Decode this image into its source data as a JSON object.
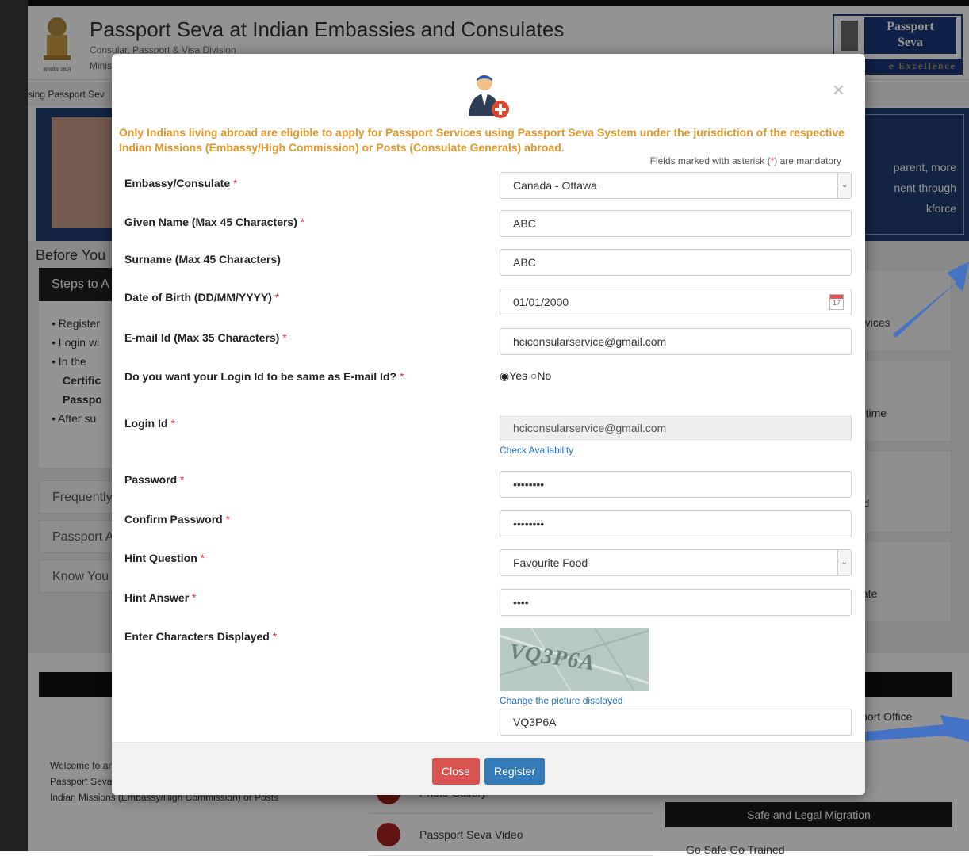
{
  "site": {
    "title": "Passport Seva at Indian Embassies and Consulates",
    "division": "Consular, Passport & Visa Division",
    "ministry": "Minis",
    "emblem_motto": "सत्यमेव जयते",
    "logo_line1": "Passport",
    "logo_line2": "Seva",
    "logo_tagline": "e Excellence",
    "ticker": "sing Passport Sev"
  },
  "hero": {
    "text_line1": "parent, more",
    "text_line2": "nent through",
    "text_line3": "kforce"
  },
  "left_panel": {
    "heading": "Before You",
    "steps_title": "Steps to A",
    "steps": [
      "Register",
      "Login wi",
      "In the"
    ],
    "bold_lines": [
      "Certific",
      "Passpo"
    ],
    "after": "After su",
    "faq": "Frequently",
    "passport_a": "Passport A",
    "know_your": "Know You"
  },
  "right_panel": {
    "services": "Services",
    "real_time": "eal time",
    "password": "vord",
    "consulate": "sulate",
    "passport_office": "Passport Office"
  },
  "bottom": {
    "welcome_text": "Welcome to and Consula to apply for Passport Services using Passport Seva System under the jurisdiction of the respective Indian Missions (Embassy/High Commission) or Posts",
    "photo_gallery": "Photo Gallery",
    "seva_video": "Passport Seva Video",
    "safe_migration": "Safe and Legal Migration",
    "go_safe": "Go Safe Go Trained"
  },
  "modal": {
    "notice": "Only Indians living abroad are eligible to apply for Passport Services using Passport Seva System under the jurisdiction of the respective Indian Missions (Embassy/High Commission) or Posts (Consulate Generals) abroad.",
    "mandatory_pre": "Fields marked with asterisk (",
    "mandatory_star": "*",
    "mandatory_post": ") are mandatory",
    "close_glyph": "×",
    "req": "*",
    "fields": {
      "embassy_label": "Embassy/Consulate",
      "embassy_value": "Canada - Ottawa",
      "given_name_label": "Given Name (Max 45 Characters)",
      "given_name_value": "ABC",
      "surname_label": "Surname (Max 45 Characters)",
      "surname_value": "ABC",
      "dob_label": "Date of Birth (DD/MM/YYYY)",
      "dob_value": "01/01/2000",
      "calendar_day": "17",
      "email_label": "E-mail Id (Max 35 Characters)",
      "email_value": "hciconsularservice@gmail.com",
      "same_login_label": "Do you want your Login Id to be same as E-mail Id?",
      "yes": "Yes",
      "no": "No",
      "login_label": "Login Id",
      "login_value": "hciconsularservice@gmail.com",
      "check_availability": "Check Availability",
      "password_label": "Password",
      "password_value": "••••••••",
      "confirm_label": "Confirm Password",
      "confirm_value": "••••••••",
      "hint_q_label": "Hint Question",
      "hint_q_value": "Favourite Food",
      "hint_a_label": "Hint Answer",
      "hint_a_value": "••••",
      "captcha_label": "Enter Characters Displayed",
      "captcha_image_text": "VQ3P6A",
      "change_picture": "Change the picture displayed",
      "captcha_value": "VQ3P6A"
    },
    "buttons": {
      "close": "Close",
      "register": "Register"
    }
  }
}
